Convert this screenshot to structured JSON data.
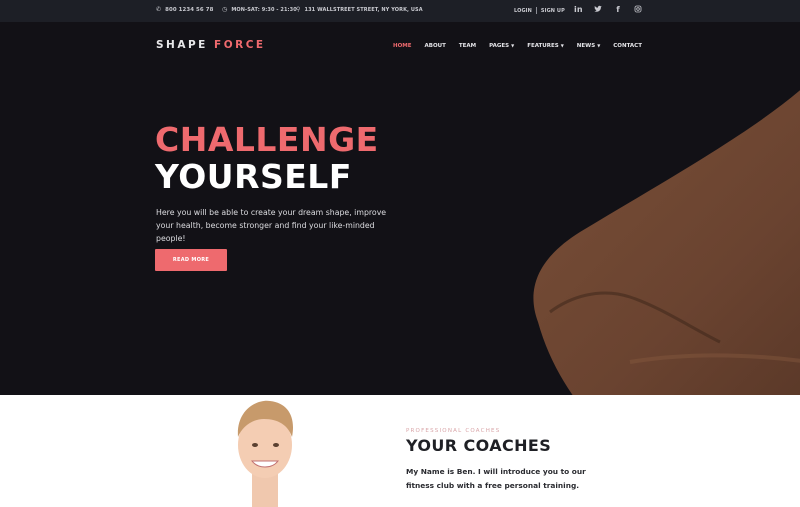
{
  "topbar": {
    "phone": "800 1234 56 78",
    "hours": "MON-SAT: 9:30 - 21:30",
    "address": "131 WALLSTREET STREET, NY YORK, USA",
    "login": "LOGIN",
    "signup": "SIGN UP",
    "icons": {
      "phone": "phone-icon",
      "clock": "clock-icon",
      "pin": "location-pin-icon"
    },
    "socials": [
      {
        "name": "linkedin-icon",
        "glyph": "in"
      },
      {
        "name": "twitter-icon",
        "glyph": "🐦"
      },
      {
        "name": "facebook-icon",
        "glyph": "f"
      },
      {
        "name": "instagram-icon",
        "glyph": "◎"
      }
    ]
  },
  "brand": {
    "part1": "SHAPE",
    "part2": "FORCE"
  },
  "nav": {
    "items": [
      {
        "label": "HOME",
        "active": true,
        "dropdown": false
      },
      {
        "label": "ABOUT",
        "active": false,
        "dropdown": false
      },
      {
        "label": "TEAM",
        "active": false,
        "dropdown": false
      },
      {
        "label": "PAGES",
        "active": false,
        "dropdown": true
      },
      {
        "label": "FEATURES",
        "active": false,
        "dropdown": true
      },
      {
        "label": "NEWS",
        "active": false,
        "dropdown": true
      },
      {
        "label": "CONTACT",
        "active": false,
        "dropdown": false
      }
    ],
    "caret": "▼"
  },
  "hero": {
    "title_line1": "CHALLENGE",
    "title_line2": "YOURSELF",
    "lead": "Here you will be able to create your dream shape, improve your health, become stronger and find your like-minded people!",
    "button": "READ MORE"
  },
  "coaches": {
    "kicker": "PROFESSIONAL COACHES",
    "title": "YOUR COACHES",
    "intro": "My Name is Ben. I will introduce you to our fitness club with a free personal training."
  },
  "colors": {
    "accent": "#ee6a6e",
    "topbar": "#1d1f26",
    "hero": "#121116"
  }
}
